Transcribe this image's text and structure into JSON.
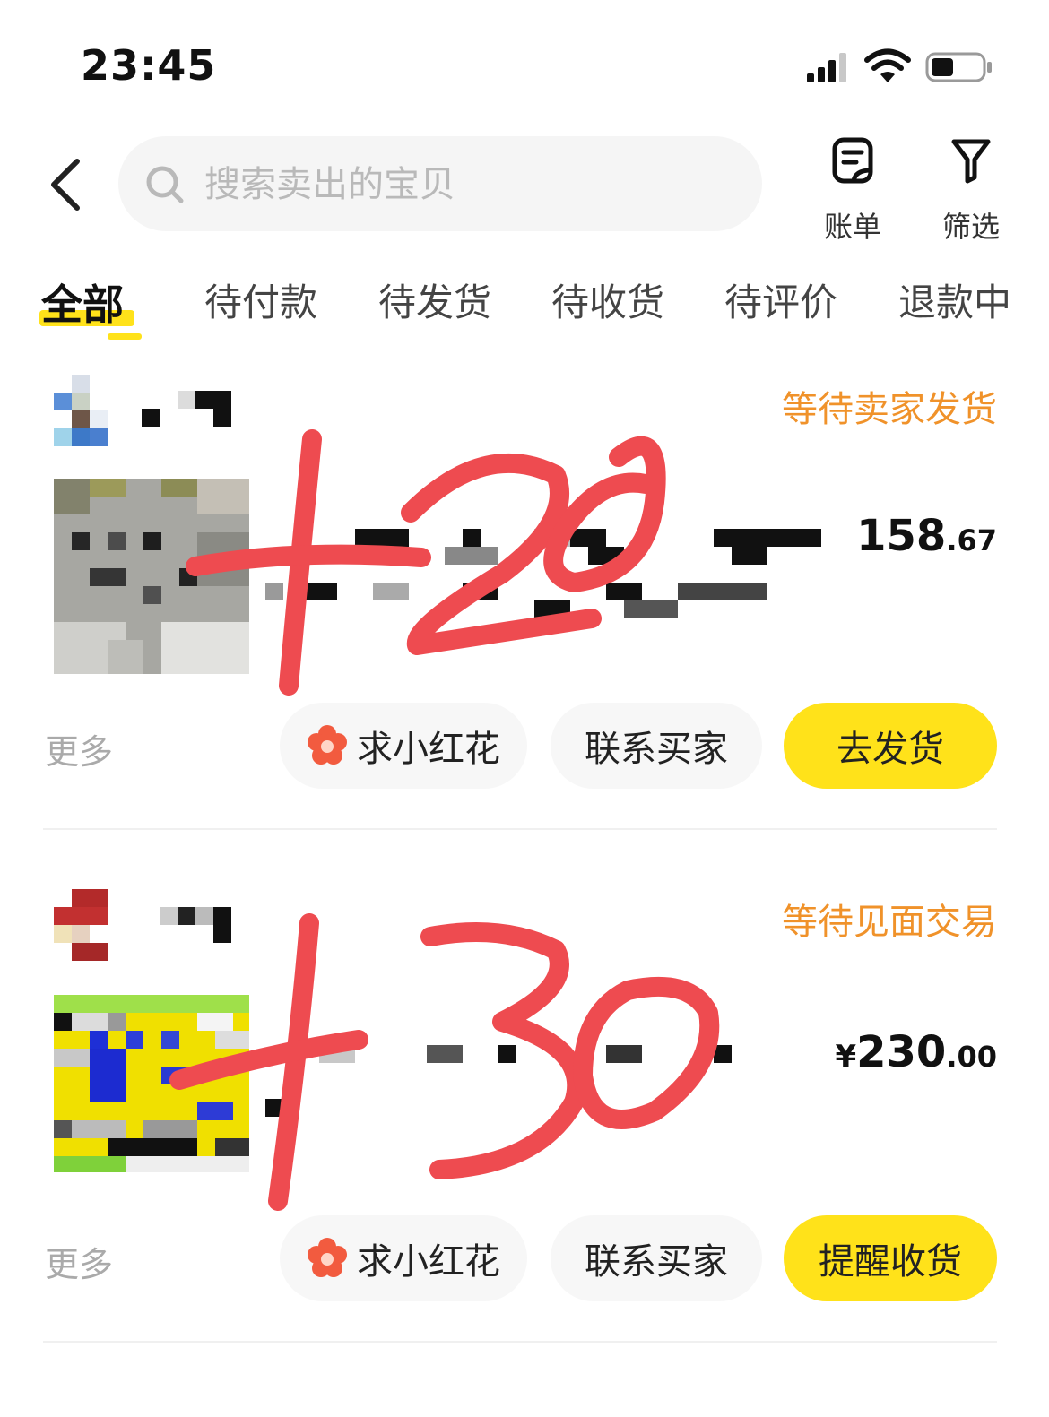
{
  "status_bar": {
    "time": "23:45",
    "icons": [
      "signal-icon",
      "wifi-icon",
      "battery-icon"
    ]
  },
  "header": {
    "back_icon": "chevron-left-icon",
    "search_placeholder": "搜索卖出的宝贝",
    "bill_label": "账单",
    "filter_label": "筛选"
  },
  "tabs": [
    {
      "label": "全部",
      "active": true
    },
    {
      "label": "待付款"
    },
    {
      "label": "待发货"
    },
    {
      "label": "待收货"
    },
    {
      "label": "待评价"
    },
    {
      "label": "退款中"
    }
  ],
  "orders": [
    {
      "status": "等待卖家发货",
      "price_int": "158",
      "price_dec": ".67",
      "more": "更多",
      "btn_flower": "求小红花",
      "btn_contact": "联系买家",
      "btn_primary": "去发货"
    },
    {
      "status": "等待见面交易",
      "price_currency": "¥",
      "price_int": "230",
      "price_dec": ".00",
      "more": "更多",
      "btn_flower": "求小红花",
      "btn_contact": "联系买家",
      "btn_primary": "提醒收货"
    }
  ],
  "colors": {
    "accent": "#ffe21a",
    "status": "#f0922a",
    "handwriting": "#ee4b50"
  }
}
